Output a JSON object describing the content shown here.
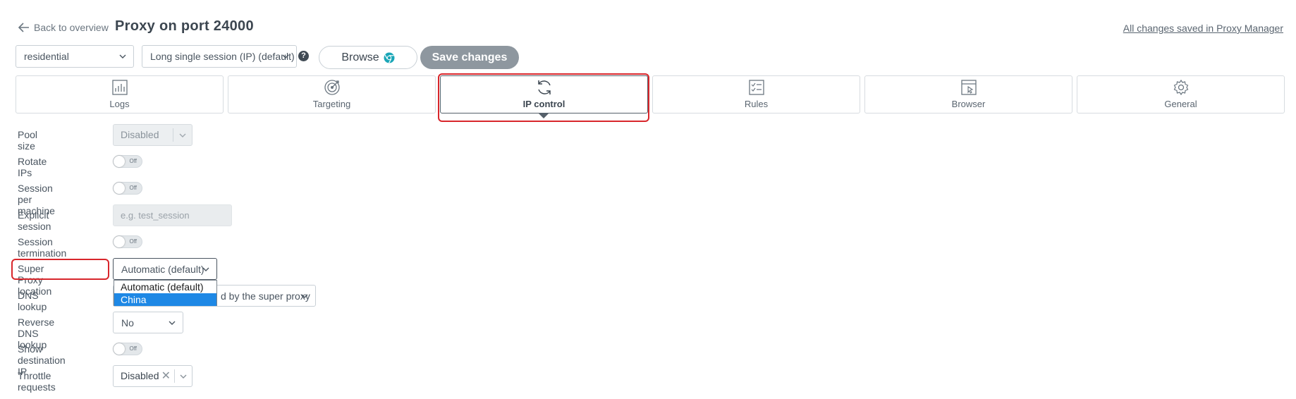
{
  "header": {
    "back_label": "Back to overview",
    "title": "Proxy on port 24000",
    "saved_status": "All changes saved in Proxy Manager"
  },
  "toolbar": {
    "preset_value": "residential",
    "session_value": "Long single session (IP) (default)",
    "help_symbol": "?",
    "browse_label": "Browse",
    "save_label": "Save changes"
  },
  "tabs": [
    {
      "label": "Logs",
      "icon": "logs-icon"
    },
    {
      "label": "Targeting",
      "icon": "targeting-icon"
    },
    {
      "label": "IP control",
      "icon": "refresh-icon",
      "active": true
    },
    {
      "label": "Rules",
      "icon": "rules-icon"
    },
    {
      "label": "Browser",
      "icon": "browser-icon"
    },
    {
      "label": "General",
      "icon": "gear-icon"
    }
  ],
  "form": {
    "pool_size": {
      "label": "Pool size",
      "value": "Disabled"
    },
    "rotate_ips": {
      "label": "Rotate IPs",
      "toggle": "Off"
    },
    "session_per_machine": {
      "label": "Session per machine",
      "toggle": "Off"
    },
    "explicit_session": {
      "label": "Explicit session",
      "placeholder": "e.g. test_session"
    },
    "session_termination": {
      "label": "Session termination",
      "toggle": "Off"
    },
    "super_proxy_location": {
      "label": "Super Proxy location",
      "value": "Automatic (default)",
      "options": [
        "Automatic (default)",
        "China"
      ],
      "highlighted_option": "China"
    },
    "dns_lookup": {
      "label": "DNS lookup",
      "value_visible_part": "d by the super proxy"
    },
    "reverse_dns": {
      "label": "Reverse DNS lookup",
      "value": "No"
    },
    "show_destination_ip": {
      "label": "Show destination IP",
      "toggle": "Off"
    },
    "throttle_requests": {
      "label": "Throttle requests",
      "value": "Disabled",
      "clear_symbol": "✕"
    }
  },
  "colors": {
    "highlight": "#d8262b",
    "save_button": "#8e979f",
    "selected_option": "#1e88e5"
  }
}
